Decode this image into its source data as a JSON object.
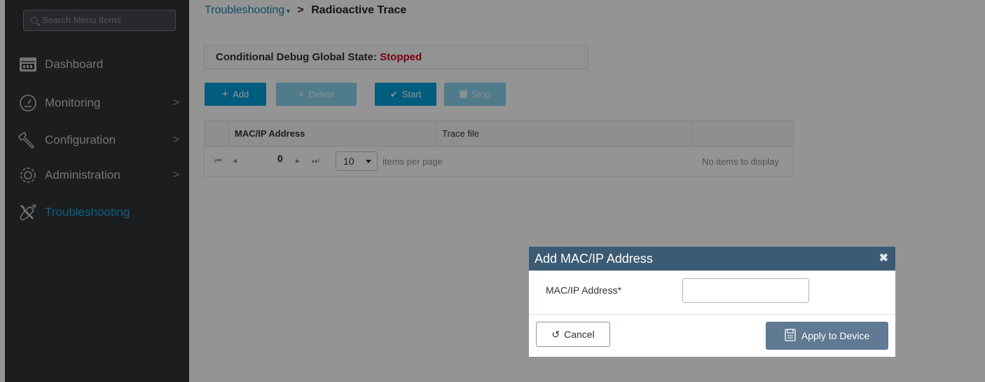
{
  "sidebar": {
    "search_placeholder": "Search Menu Items",
    "items": [
      {
        "label": "Dashboard",
        "icon": "dashboard-icon",
        "has_submenu": false
      },
      {
        "label": "Monitoring",
        "icon": "gauge-icon",
        "has_submenu": true
      },
      {
        "label": "Configuration",
        "icon": "wrench-icon",
        "has_submenu": true
      },
      {
        "label": "Administration",
        "icon": "gear-icon",
        "has_submenu": true
      },
      {
        "label": "Troubleshooting",
        "icon": "tools-icon",
        "has_submenu": false,
        "active": true
      }
    ],
    "chevron": ">"
  },
  "breadcrumb": {
    "parent": "Troubleshooting",
    "separator": ">",
    "current": "Radioactive Trace"
  },
  "state": {
    "label": "Conditional Debug Global State:",
    "value": "Stopped",
    "value_color": "#d0021b"
  },
  "toolbar": {
    "add_label": "Add",
    "add_icon": "+",
    "delete_label": "Delete",
    "delete_icon": "×",
    "start_label": "Start",
    "start_icon": "✔",
    "stop_label": "Stop"
  },
  "table": {
    "columns": [
      "MAC/IP Address",
      "Trace file",
      ""
    ],
    "pager": {
      "page": "0",
      "page_size": "10",
      "items_per_page_label": "items per page",
      "empty_message": "No items to display"
    }
  },
  "modal": {
    "title": "Add MAC/IP Address",
    "close_icon": "✖",
    "field_label": "MAC/IP Address*",
    "field_value": "",
    "cancel_label": "Cancel",
    "cancel_icon": "↺",
    "apply_label": "Apply to Device"
  },
  "colors": {
    "accent": "#049fd9",
    "sidebar_bg": "#2f3236",
    "modal_header": "#3b5a73"
  }
}
